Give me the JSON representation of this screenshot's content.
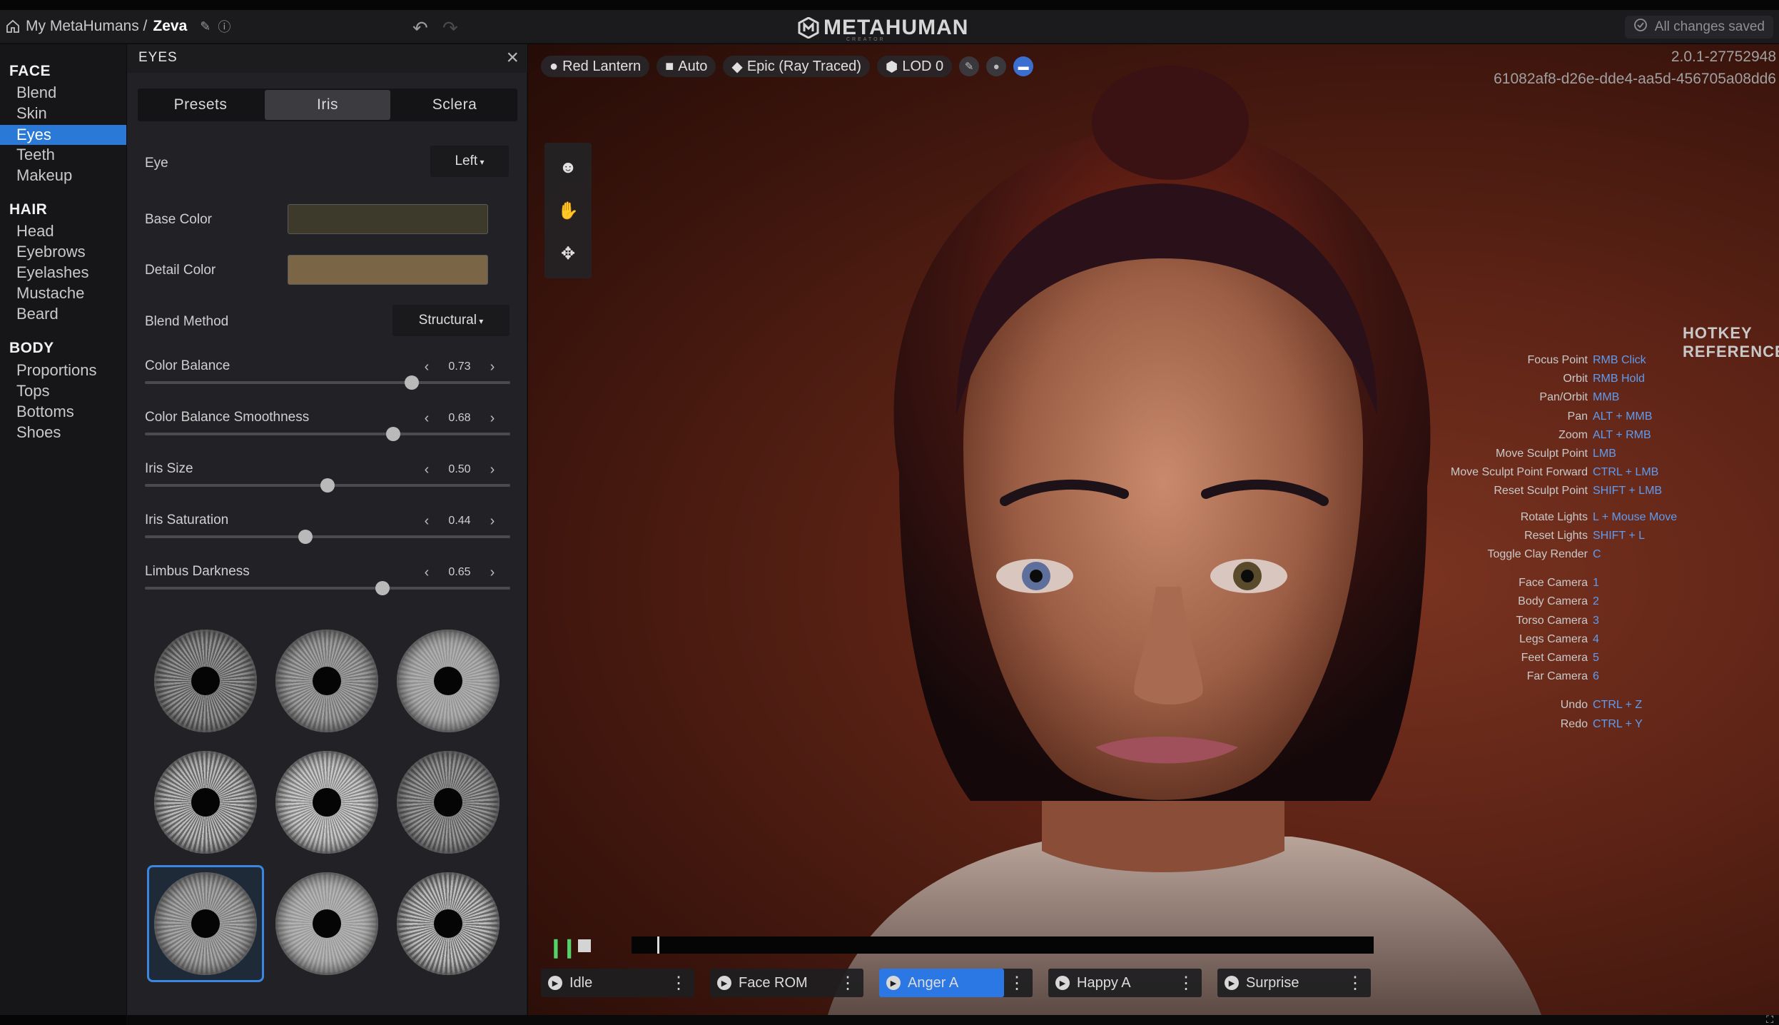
{
  "header": {
    "breadcrumb_root": "My MetaHumans /",
    "character_name": "Zeva",
    "brand": "METAHUMAN",
    "brand_sub": "CREATOR",
    "save_status": "All changes saved"
  },
  "nav": {
    "sections": [
      {
        "title": "FACE",
        "items": [
          "Blend",
          "Skin",
          "Eyes",
          "Teeth",
          "Makeup"
        ]
      },
      {
        "title": "HAIR",
        "items": [
          "Head",
          "Eyebrows",
          "Eyelashes",
          "Mustache",
          "Beard"
        ]
      },
      {
        "title": "BODY",
        "items": [
          "Proportions",
          "Tops",
          "Bottoms",
          "Shoes"
        ]
      }
    ],
    "active_item": "Eyes"
  },
  "panel": {
    "title": "EYES",
    "tabs": [
      "Presets",
      "Iris",
      "Sclera"
    ],
    "active_tab": "Iris",
    "eye_label": "Eye",
    "eye_value": "Left",
    "base_color_label": "Base Color",
    "base_color": "#3d3a2c",
    "detail_color_label": "Detail Color",
    "detail_color": "#7a6647",
    "blend_method_label": "Blend Method",
    "blend_method_value": "Structural",
    "sliders": [
      {
        "label": "Color Balance",
        "value": "0.73",
        "fraction": 0.73
      },
      {
        "label": "Color Balance Smoothness",
        "value": "0.68",
        "fraction": 0.68
      },
      {
        "label": "Iris Size",
        "value": "0.50",
        "fraction": 0.5
      },
      {
        "label": "Iris Saturation",
        "value": "0.44",
        "fraction": 0.44
      },
      {
        "label": "Limbus Darkness",
        "value": "0.65",
        "fraction": 0.65
      }
    ],
    "iris_presets_count": 9,
    "selected_preset_index": 6
  },
  "viewport": {
    "toolbar": {
      "lighting": "Red Lantern",
      "camera": "Auto",
      "quality": "Epic (Ray Traced)",
      "lod": "LOD 0"
    },
    "version": "2.0.1-27752948",
    "guid": "61082af8-d26e-dde4-aa5d-456705a08dd6",
    "hotkeys_title": "HOTKEY REFERENCE",
    "hotkeys": [
      {
        "action": "Focus Point",
        "key": "RMB Click"
      },
      {
        "action": "Orbit",
        "key": "RMB Hold"
      },
      {
        "action": "Pan/Orbit",
        "key": "MMB"
      },
      {
        "action": "Pan",
        "key": "ALT + MMB"
      },
      {
        "action": "Zoom",
        "key": "ALT + RMB"
      },
      {
        "action": "Move Sculpt Point",
        "key": "LMB"
      },
      {
        "action": "Move Sculpt Point Forward",
        "key": "CTRL + LMB"
      },
      {
        "action": "Reset Sculpt Point",
        "key": "SHIFT + LMB"
      },
      {
        "action": "Rotate Lights",
        "key": "L + Mouse Move"
      },
      {
        "action": "Reset Lights",
        "key": "SHIFT + L"
      },
      {
        "action": "Toggle Clay Render",
        "key": "C"
      },
      {
        "action": "Face Camera",
        "key": "1"
      },
      {
        "action": "Body Camera",
        "key": "2"
      },
      {
        "action": "Torso Camera",
        "key": "3"
      },
      {
        "action": "Legs Camera",
        "key": "4"
      },
      {
        "action": "Feet Camera",
        "key": "5"
      },
      {
        "action": "Far Camera",
        "key": "6"
      },
      {
        "action": "Undo",
        "key": "CTRL + Z"
      },
      {
        "action": "Redo",
        "key": "CTRL + Y"
      }
    ],
    "animations": [
      "Idle",
      "Face ROM",
      "Anger A",
      "Happy A",
      "Surprise"
    ],
    "active_animation": "Anger A",
    "colors": {
      "accent": "#2b78e4",
      "hotkey": "#5d9cf0",
      "play": "#54d36a"
    }
  }
}
